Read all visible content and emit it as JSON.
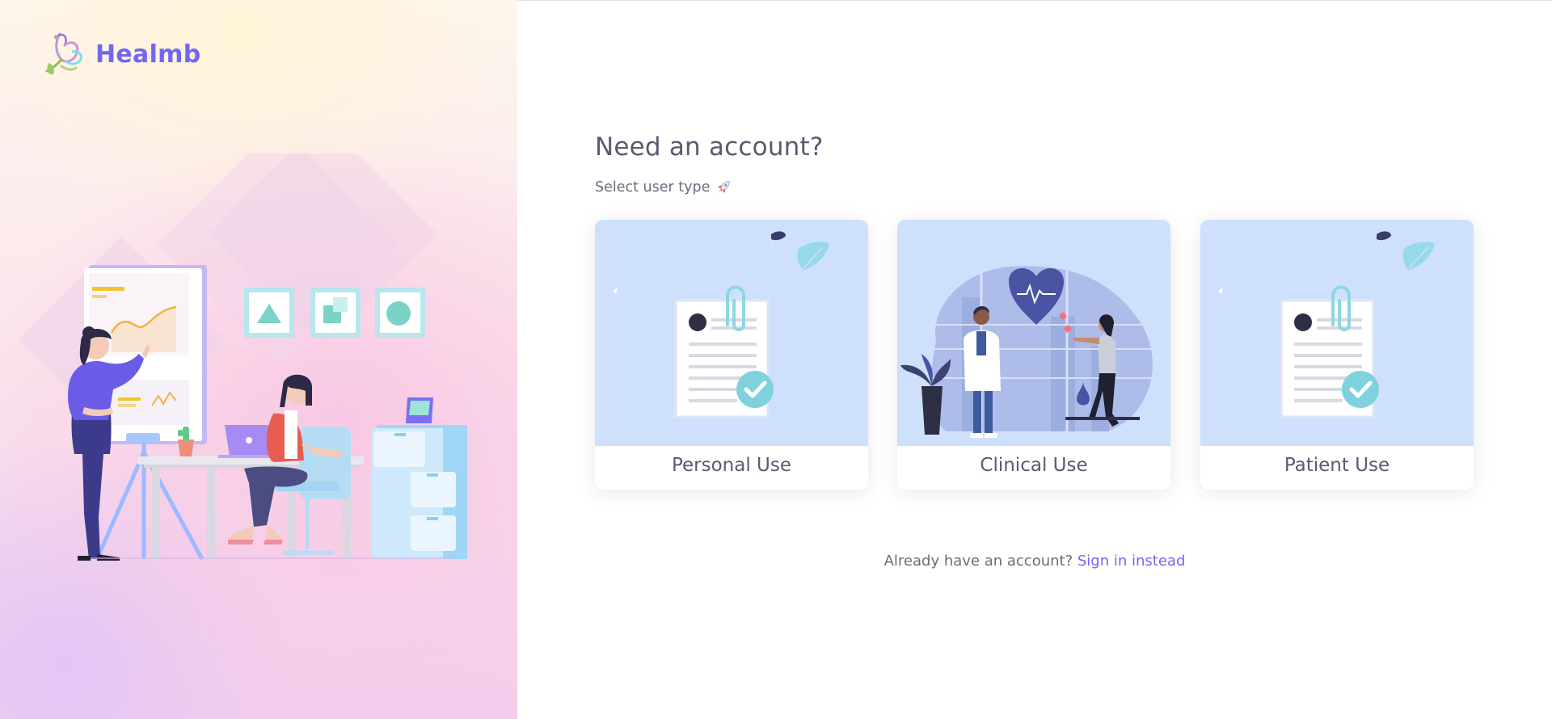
{
  "brand": {
    "name": "Healmb",
    "logo_icon": "lotus-logo-icon",
    "accent_color": "#7367f0"
  },
  "signup": {
    "title": "Need an account?",
    "subtitle": "Select user type",
    "subtitle_icon": "rocket-icon"
  },
  "user_types": [
    {
      "label": "Personal Use",
      "illustration": "document-check-illustration"
    },
    {
      "label": "Clinical Use",
      "illustration": "doctor-heart-illustration"
    },
    {
      "label": "Patient Use",
      "illustration": "document-check-illustration"
    }
  ],
  "footer": {
    "prompt": "Already have an account?",
    "link": "Sign in instead"
  }
}
